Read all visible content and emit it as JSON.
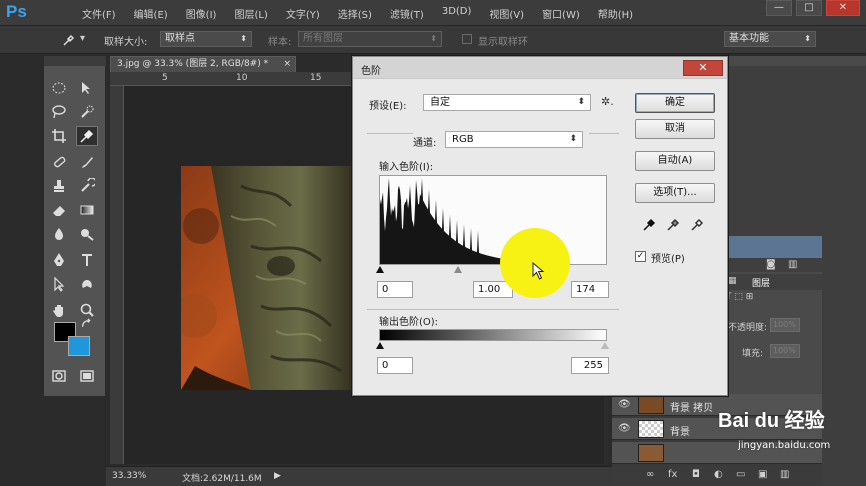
{
  "app": {
    "logo": "Ps",
    "menu": [
      "文件(F)",
      "编辑(E)",
      "图像(I)",
      "图层(L)",
      "文字(Y)",
      "选择(S)",
      "滤镜(T)",
      "3D(D)",
      "视图(V)",
      "窗口(W)",
      "帮助(H)"
    ],
    "window_controls": {
      "minimize": "—",
      "maximize": "□",
      "close": "✕"
    }
  },
  "options_bar": {
    "sample_size_label": "取样大小:",
    "sample_size_value": "取样点",
    "sample_label": "样本:",
    "sample_value": "所有图层",
    "show_ring_label": "显示取样环",
    "workspace": "基本功能"
  },
  "document": {
    "tab_title": "3.jpg @ 33.3% (图层 2, RGB/8#) *",
    "tab_close": "×",
    "ruler_marks": [
      "5",
      "10",
      "15"
    ],
    "zoom": "33.33%",
    "doc_size": "文档:2.62M/11.6M"
  },
  "levels_dialog": {
    "title": "色阶",
    "close": "✕",
    "preset_label": "预设(E):",
    "preset_value": "自定",
    "channel_label": "通道:",
    "channel_value": "RGB",
    "input_levels_label": "输入色阶(I):",
    "input_black": "0",
    "input_gamma": "1.00",
    "input_white": "174",
    "output_levels_label": "输出色阶(O):",
    "output_black": "0",
    "output_white": "255",
    "buttons": {
      "ok": "确定",
      "cancel": "取消",
      "auto": "自动(A)",
      "options": "选项(T)..."
    },
    "preview_label": "预览(P)",
    "preview_checked": "✓"
  },
  "layers_panel": {
    "tab": "图层",
    "opacity_label": "不透明度:",
    "opacity_value": "100%",
    "fill_label": "填充:",
    "fill_value": "100%",
    "layers": [
      {
        "name": "背景 拷贝",
        "visible": true
      },
      {
        "name": "背景",
        "visible": true
      },
      {
        "name": "",
        "visible": false
      }
    ]
  },
  "watermark": {
    "main": "Bai du 经验",
    "sub": "jingyan.baidu.com"
  },
  "colors": {
    "foreground": "#000000",
    "background": "#1e98d8",
    "highlight": "#f8f214",
    "accent": "#3ea2ea"
  }
}
